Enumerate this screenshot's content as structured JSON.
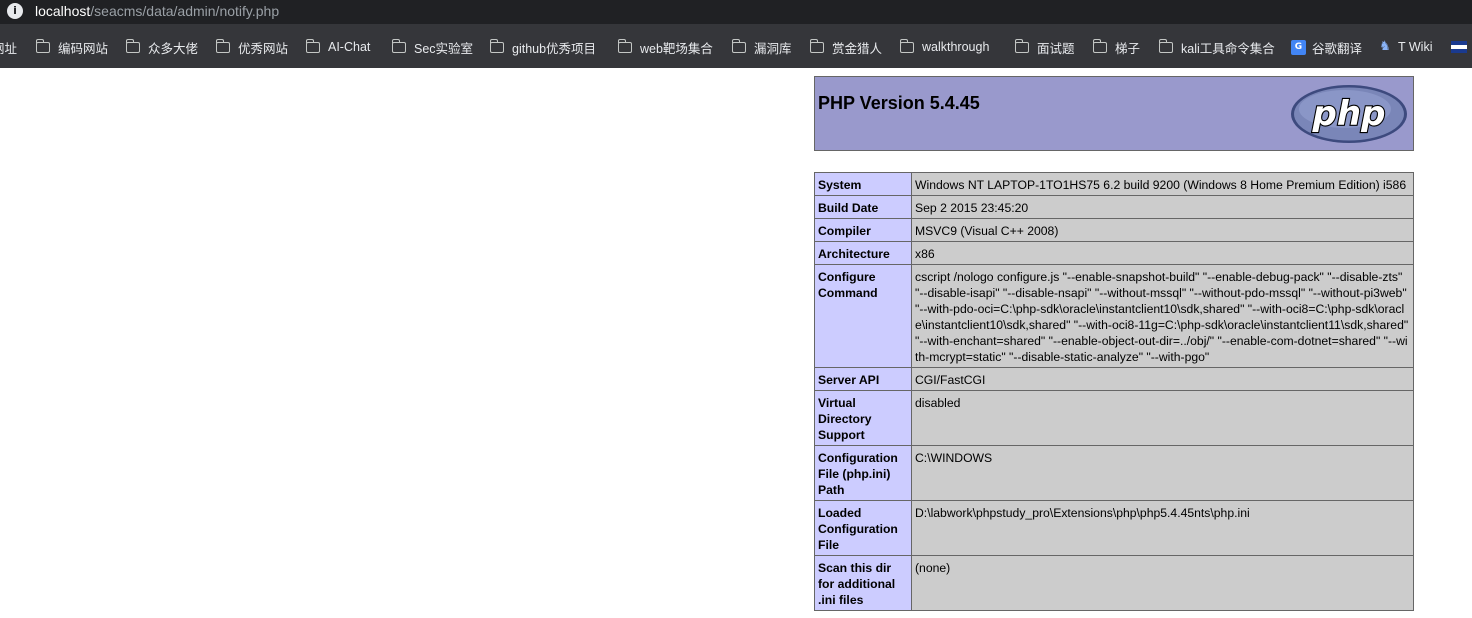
{
  "address_bar": {
    "host": "localhost",
    "path": "/seacms/data/admin/notify.php"
  },
  "bookmarks": [
    {
      "label": "网址",
      "icon": "none"
    },
    {
      "label": "编码网站",
      "icon": "folder-icon"
    },
    {
      "label": "众多大佬",
      "icon": "folder-icon"
    },
    {
      "label": "优秀网站",
      "icon": "folder-icon"
    },
    {
      "label": "AI-Chat",
      "icon": "folder-icon"
    },
    {
      "label": "Sec实验室",
      "icon": "folder-icon"
    },
    {
      "label": "github优秀项目",
      "icon": "folder-icon"
    },
    {
      "label": "web靶场集合",
      "icon": "folder-icon"
    },
    {
      "label": "漏洞库",
      "icon": "folder-icon"
    },
    {
      "label": "赏金猎人",
      "icon": "folder-icon"
    },
    {
      "label": "walkthrough",
      "icon": "folder-icon"
    },
    {
      "label": "面试题",
      "icon": "folder-icon"
    },
    {
      "label": "梯子",
      "icon": "folder-icon"
    },
    {
      "label": "kali工具命令集合",
      "icon": "folder-icon"
    },
    {
      "label": "谷歌翻译",
      "icon": "google-translate-icon"
    },
    {
      "label": "T Wiki",
      "icon": "wiki-icon"
    }
  ],
  "php_header": {
    "title": "PHP Version 5.4.45",
    "logo_text": "php"
  },
  "info_rows": [
    {
      "key": "System",
      "value": "Windows NT LAPTOP-1TO1HS75 6.2 build 9200 (Windows 8 Home Premium Edition) i586"
    },
    {
      "key": "Build Date",
      "value": "Sep 2 2015 23:45:20"
    },
    {
      "key": "Compiler",
      "value": "MSVC9 (Visual C++ 2008)"
    },
    {
      "key": "Architecture",
      "value": "x86"
    },
    {
      "key": "Configure Command",
      "value": "cscript /nologo configure.js \"--enable-snapshot-build\" \"--enable-debug-pack\" \"--disable-zts\" \"--disable-isapi\" \"--disable-nsapi\" \"--without-mssql\" \"--without-pdo-mssql\" \"--without-pi3web\" \"--with-pdo-oci=C:\\php-sdk\\oracle\\instantclient10\\sdk,shared\" \"--with-oci8=C:\\php-sdk\\oracle\\instantclient10\\sdk,shared\" \"--with-oci8-11g=C:\\php-sdk\\oracle\\instantclient11\\sdk,shared\" \"--with-enchant=shared\" \"--enable-object-out-dir=../obj/\" \"--enable-com-dotnet=shared\" \"--with-mcrypt=static\" \"--disable-static-analyze\" \"--with-pgo\""
    },
    {
      "key": "Server API",
      "value": "CGI/FastCGI"
    },
    {
      "key": "Virtual Directory Support",
      "value": "disabled"
    },
    {
      "key": "Configuration File (php.ini) Path",
      "value": "C:\\WINDOWS"
    },
    {
      "key": "Loaded Configuration File",
      "value": "D:\\labwork\\phpstudy_pro\\Extensions\\php\\php5.4.45nts\\php.ini"
    },
    {
      "key": "Scan this dir for additional .ini files",
      "value": "(none)"
    }
  ]
}
